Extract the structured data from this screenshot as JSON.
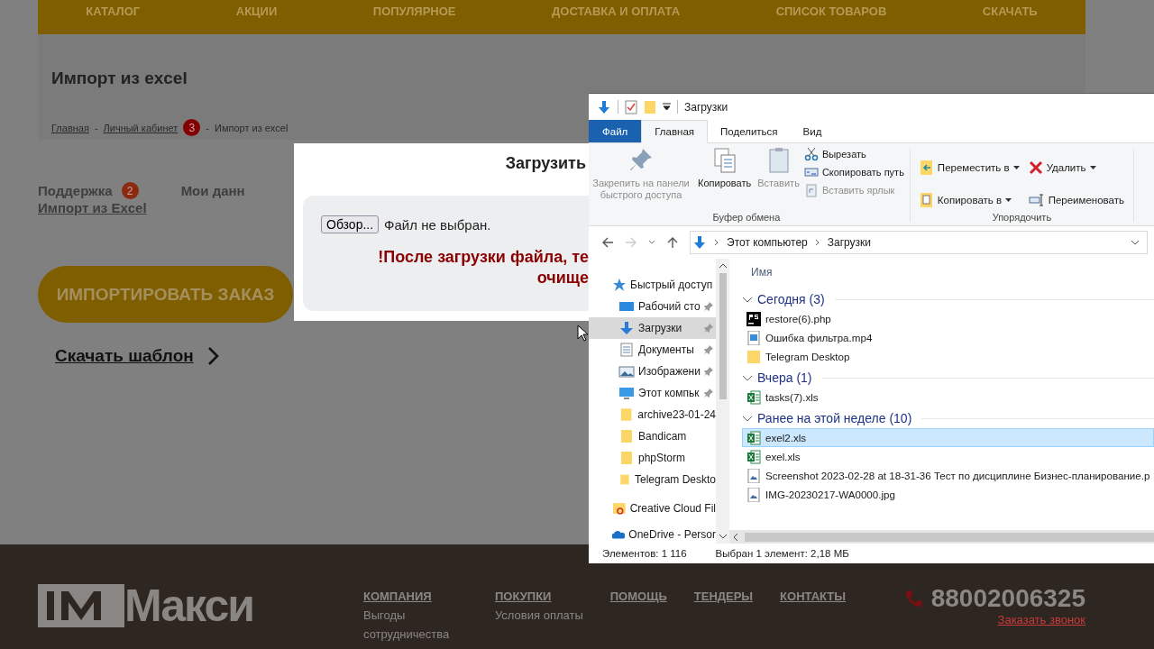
{
  "site": {
    "nav": [
      "КАТАЛОГ",
      "АКЦИИ",
      "ПОПУЛЯРНОЕ",
      "ДОСТАВКА И ОПЛАТА",
      "СПИСОК ТОВАРОВ",
      "СКАЧАТЬ"
    ],
    "page_title": "Импорт из excel",
    "breadcrumbs": [
      {
        "label": "Главная",
        "kind": "link",
        "separator": "-"
      },
      {
        "label": "Личный кабинет",
        "kind": "link",
        "badge": "3",
        "separator": "-"
      },
      {
        "label": "Импорт из excel",
        "kind": "current"
      }
    ],
    "account_menu": [
      [
        {
          "label": "Поддержка",
          "badge": "2",
          "selected": false
        },
        {
          "label": "Импорт из Excel",
          "selected": true
        }
      ],
      [
        {
          "label": "Мои данн",
          "selected": false
        }
      ]
    ],
    "import_button": "ИМПОРТИРОВАТЬ ЗАКАЗ",
    "template_link": "Скачать шаблон"
  },
  "modal": {
    "title": "Загрузить",
    "browse_button": "Обзор...",
    "file_status": "Файл не выбран.",
    "warning": [
      "!После загрузки файла, те",
      "очище"
    ]
  },
  "explorer": {
    "title": "Загрузки",
    "tabs": [
      {
        "label": "Файл",
        "kind": "menu",
        "selected": false
      },
      {
        "label": "Главная",
        "kind": "tab",
        "selected": true
      },
      {
        "label": "Поделиться",
        "kind": "tab",
        "selected": false
      },
      {
        "label": "Вид",
        "kind": "tab",
        "selected": false
      }
    ],
    "clipboard": {
      "label": "Буфер обмена",
      "tools": [
        {
          "label": "Закрепить на панели быстрого доступа",
          "kind": "pin",
          "disabled": true
        },
        {
          "label": "Копировать",
          "kind": "copy",
          "disabled": false
        },
        {
          "label": "Вставить",
          "kind": "paste",
          "disabled": true
        }
      ],
      "small_tools": [
        {
          "label": "Вырезать",
          "kind": "cut",
          "disabled": false
        },
        {
          "label": "Скопировать путь",
          "kind": "path",
          "disabled": false
        },
        {
          "label": "Вставить ярлык",
          "kind": "shortcut",
          "disabled": true
        }
      ]
    },
    "organize": {
      "label": "Упорядочить",
      "tools": [
        {
          "label": "Переместить в",
          "kind": "move",
          "has_menu": true
        },
        {
          "label": "Удалить",
          "kind": "delete",
          "has_menu": true
        },
        {
          "label": "Копировать в",
          "kind": "copyto",
          "has_menu": true
        },
        {
          "label": "Переименовать",
          "kind": "rename",
          "has_menu": false
        }
      ]
    },
    "path": [
      "Этот компьютер",
      "Загрузки"
    ],
    "nav_pane": [
      {
        "label": "Быстрый доступ",
        "kind": "star",
        "selected": false,
        "children": [
          {
            "label": "Рабочий сто",
            "kind": "desktop",
            "pinned": true,
            "selected": false
          },
          {
            "label": "Загрузки",
            "kind": "download",
            "pinned": true,
            "selected": true
          },
          {
            "label": "Документы",
            "kind": "documents",
            "pinned": true,
            "selected": false
          },
          {
            "label": "Изображени",
            "kind": "pictures",
            "pinned": true,
            "selected": false
          },
          {
            "label": "Этот компьк",
            "kind": "computer",
            "pinned": true,
            "selected": false
          },
          {
            "label": "archive23-01-24",
            "kind": "folder",
            "pinned": false,
            "selected": false
          },
          {
            "label": "Bandicam",
            "kind": "folder",
            "pinned": false,
            "selected": false
          },
          {
            "label": "phpStorm",
            "kind": "folder",
            "pinned": false,
            "selected": false
          },
          {
            "label": "Telegram Deskto",
            "kind": "folder",
            "pinned": false,
            "selected": false
          }
        ]
      },
      {
        "label": "Creative Cloud Fil",
        "kind": "cloudfiles",
        "selected": false
      },
      {
        "label": "OneDrive - Persor",
        "kind": "onedrive",
        "selected": false
      }
    ],
    "column_header": "Имя",
    "groups": [
      {
        "label": "Сегодня (3)",
        "expanded": true,
        "files": [
          {
            "name": "restore(6).php",
            "kind": "php",
            "selected": false
          },
          {
            "name": "Ошибка фильтра.mp4",
            "kind": "video",
            "selected": false
          },
          {
            "name": "Telegram Desktop",
            "kind": "folder",
            "selected": false
          }
        ]
      },
      {
        "label": "Вчера (1)",
        "expanded": true,
        "files": [
          {
            "name": "tasks(7).xls",
            "kind": "excel",
            "selected": false
          }
        ]
      },
      {
        "label": "Ранее на этой неделе (10)",
        "expanded": true,
        "files": [
          {
            "name": "exel2.xls",
            "kind": "excel",
            "selected": true
          },
          {
            "name": "exel.xls",
            "kind": "excel",
            "selected": false
          },
          {
            "name": "Screenshot 2023-02-28 at 18-31-36 Тест по дисциплине Бизнес-планирование.p",
            "kind": "image",
            "selected": false
          },
          {
            "name": "IMG-20230217-WA0000.jpg",
            "kind": "image",
            "selected": false
          }
        ]
      }
    ],
    "status": [
      "Элементов: 1 116",
      "Выбран 1 элемент: 2,18 МБ"
    ]
  },
  "footer": {
    "logo": "Макси",
    "columns": [
      {
        "heading": "КОМПАНИЯ",
        "links": [
          "Выгоды сотрудничества"
        ]
      },
      {
        "heading": "ПОКУПКИ",
        "links": [
          "Условия оплаты"
        ]
      },
      {
        "heading": "ПОМОЩЬ"
      },
      {
        "heading": "ТЕНДЕРЫ"
      },
      {
        "heading": "КОНТАКТЫ"
      }
    ],
    "phone": "88002006325",
    "callback": "Заказать звонок"
  }
}
